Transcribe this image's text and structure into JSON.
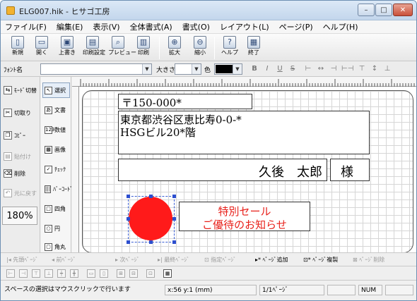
{
  "window": {
    "title": "ELG007.hik - ヒサゴ工房",
    "minimize": "–",
    "maximize": "□",
    "close": "✕"
  },
  "menu": [
    "ファイル(F)",
    "編集(E)",
    "表示(V)",
    "全体書式(A)",
    "書式(O)",
    "レイアウト(L)",
    "ページ(P)",
    "ヘルプ(H)"
  ],
  "toolbar": [
    {
      "label": "新規",
      "icon": "new-file-icon",
      "glyph": "▯"
    },
    {
      "label": "開く",
      "icon": "open-folder-icon",
      "glyph": "▭"
    },
    {
      "label": "上書き",
      "icon": "save-icon",
      "glyph": "▣"
    },
    {
      "label": "印刷設定",
      "icon": "print-setup-icon",
      "glyph": "▤"
    },
    {
      "label": "プレビュー",
      "icon": "preview-icon",
      "glyph": "⌕"
    },
    {
      "label": "印刷",
      "icon": "printer-icon",
      "glyph": "▥"
    },
    {
      "label": "拡大",
      "icon": "zoom-in-icon",
      "glyph": "⊕"
    },
    {
      "label": "縮小",
      "icon": "zoom-out-icon",
      "glyph": "⊖"
    },
    {
      "label": "ヘルプ",
      "icon": "help-icon",
      "glyph": "?"
    },
    {
      "label": "終了",
      "icon": "exit-icon",
      "glyph": "▦"
    }
  ],
  "fontbar": {
    "font_label": "ﾌｫﾝﾄ名",
    "font_value": "",
    "size_label": "大きさ",
    "size_value": "",
    "color_label": "色",
    "color_value": "#000000",
    "format_buttons": [
      "B",
      "I",
      "U",
      "S",
      "⊢",
      "↔",
      "⊣",
      "⊢⊣",
      "⊤",
      "↕",
      "⊥"
    ]
  },
  "left_panel": {
    "items": [
      {
        "label": "ﾓｰﾄﾞ切替",
        "icon": "mode-switch-icon",
        "glyph": "⇆",
        "enabled": true
      },
      {
        "label": "切取り",
        "icon": "cut-icon",
        "glyph": "✂",
        "enabled": true
      },
      {
        "label": "ｺﾋﾟｰ",
        "icon": "copy-icon",
        "glyph": "❐",
        "enabled": true
      },
      {
        "label": "貼付け",
        "icon": "paste-icon",
        "glyph": "▤",
        "enabled": false
      },
      {
        "label": "削除",
        "icon": "delete-icon",
        "glyph": "⌫",
        "enabled": true
      },
      {
        "label": "元に戻す",
        "icon": "undo-icon",
        "glyph": "↶",
        "enabled": false
      }
    ],
    "zoom": "180%"
  },
  "tools": [
    {
      "label": "選択",
      "icon": "select-icon",
      "glyph": "↖",
      "selected": true
    },
    {
      "label": "文書",
      "icon": "text-icon",
      "glyph": "あ",
      "selected": false
    },
    {
      "label": "数値",
      "icon": "number-icon",
      "glyph": "123",
      "selected": false
    },
    {
      "label": "画像",
      "icon": "image-icon",
      "glyph": "▩",
      "selected": false
    },
    {
      "label": "ﾁｪｯｸ",
      "icon": "check-icon",
      "glyph": "✓",
      "selected": false
    },
    {
      "label": "ﾊﾞｰｺｰﾄﾞ",
      "icon": "barcode-icon",
      "glyph": "|||",
      "selected": false
    },
    {
      "label": "四角",
      "icon": "rectangle-icon",
      "glyph": "□",
      "selected": false
    },
    {
      "label": "円",
      "icon": "circle-icon",
      "glyph": "○",
      "selected": false
    },
    {
      "label": "角丸",
      "icon": "rounded-rect-icon",
      "glyph": "▢",
      "selected": false
    }
  ],
  "document": {
    "postal": "〒150-000*",
    "address1": "東京都渋谷区恵比寿0-0-*",
    "address2": "HSGビル20*階",
    "name": "久後　太郎",
    "honorific": "様",
    "promo_line1": "特別セール",
    "promo_line2": "ご優待のお知らせ",
    "circle_color": "#ff1a1a",
    "promo_color": "#e8201a"
  },
  "navigation": [
    {
      "label": "|◂ 先頭ﾍﾟｰｼﾞ",
      "enabled": false
    },
    {
      "label": "◂ 前ﾍﾟｰｼﾞ",
      "enabled": false
    },
    {
      "label": "▸ 次ﾍﾟｰｼﾞ",
      "enabled": false
    },
    {
      "label": "▸| 最終ﾍﾟｰｼﾞ",
      "enabled": false
    },
    {
      "label": "⊡ 指定ﾍﾟｰｼﾞ",
      "enabled": false
    },
    {
      "label": "▸* ﾍﾟｰｼﾞ追加",
      "enabled": true
    },
    {
      "label": "⊡* ﾍﾟｰｼﾞ複製",
      "enabled": true
    },
    {
      "label": "⊠ ﾍﾟｰｼﾞ削除",
      "enabled": false
    }
  ],
  "align_tools": [
    "⊢",
    "⊣",
    "⊤",
    "⊥",
    "┿",
    "╋",
    "▭",
    "▯",
    "⊞",
    "⊟",
    "⊡",
    "▦"
  ],
  "status": {
    "message": "スペースの選択はマウスクリックで行います",
    "coords": "x:56 y:1 (mm)",
    "page": "1/1ﾍﾟｰｼﾞ",
    "mode": "",
    "num": "NUM"
  }
}
